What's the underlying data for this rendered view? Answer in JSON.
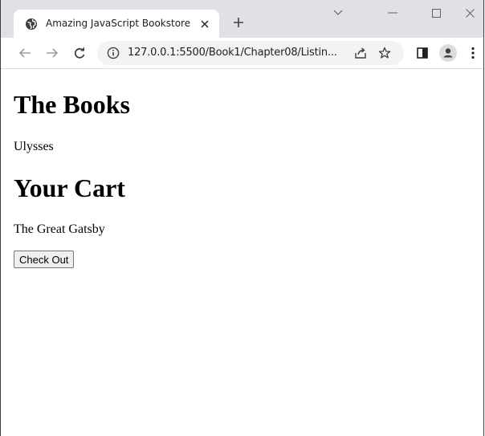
{
  "browser": {
    "tab": {
      "title": "Amazing JavaScript Bookstore",
      "favicon": "globe-icon",
      "close_icon": "close-icon"
    },
    "new_tab_icon": "plus-icon",
    "window_controls": [
      "chevron-down-icon",
      "minimize-icon",
      "maximize-icon",
      "close-icon"
    ],
    "toolbar": {
      "back_icon": "back-arrow-icon",
      "forward_icon": "forward-arrow-icon",
      "reload_icon": "reload-icon",
      "site_info_icon": "info-icon",
      "url": "127.0.0.1:5500/Book1/Chapter08/Listin...",
      "share_icon": "share-icon",
      "bookmark_icon": "star-icon",
      "side_panel_icon": "side-panel-icon",
      "profile_icon": "profile-icon",
      "menu_icon": "kebab-menu-icon"
    },
    "colors": {
      "tabstrip_bg": "#dfe1e5",
      "omnibox_bg": "#f1f3f4",
      "icon": "#5f6368"
    }
  },
  "page": {
    "books_heading": "The Books",
    "books": [
      "Ulysses"
    ],
    "cart_heading": "Your Cart",
    "cart_items": [
      "The Great Gatsby"
    ],
    "checkout_label": "Check Out"
  }
}
